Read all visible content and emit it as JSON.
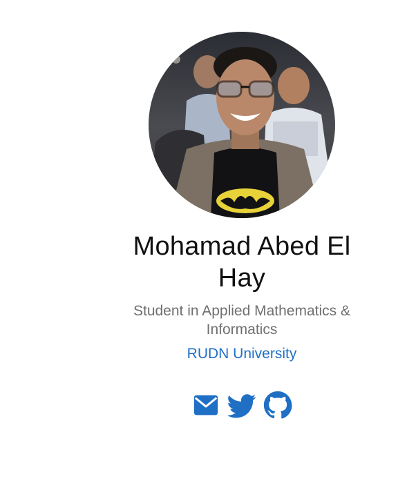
{
  "profile": {
    "name": "Mohamad Abed El Hay",
    "subtitle": "Student in Applied Mathematics & Informatics",
    "affiliation": "RUDN University",
    "avatar_icon": "profile-photo",
    "social": [
      {
        "icon": "envelope-icon",
        "label": "Email"
      },
      {
        "icon": "twitter-icon",
        "label": "Twitter"
      },
      {
        "icon": "github-icon",
        "label": "GitHub"
      }
    ]
  },
  "colors": {
    "accent": "#1f6fc5",
    "name_text": "#111111",
    "subtitle_text": "#6f6f6f",
    "background": "#ffffff"
  }
}
